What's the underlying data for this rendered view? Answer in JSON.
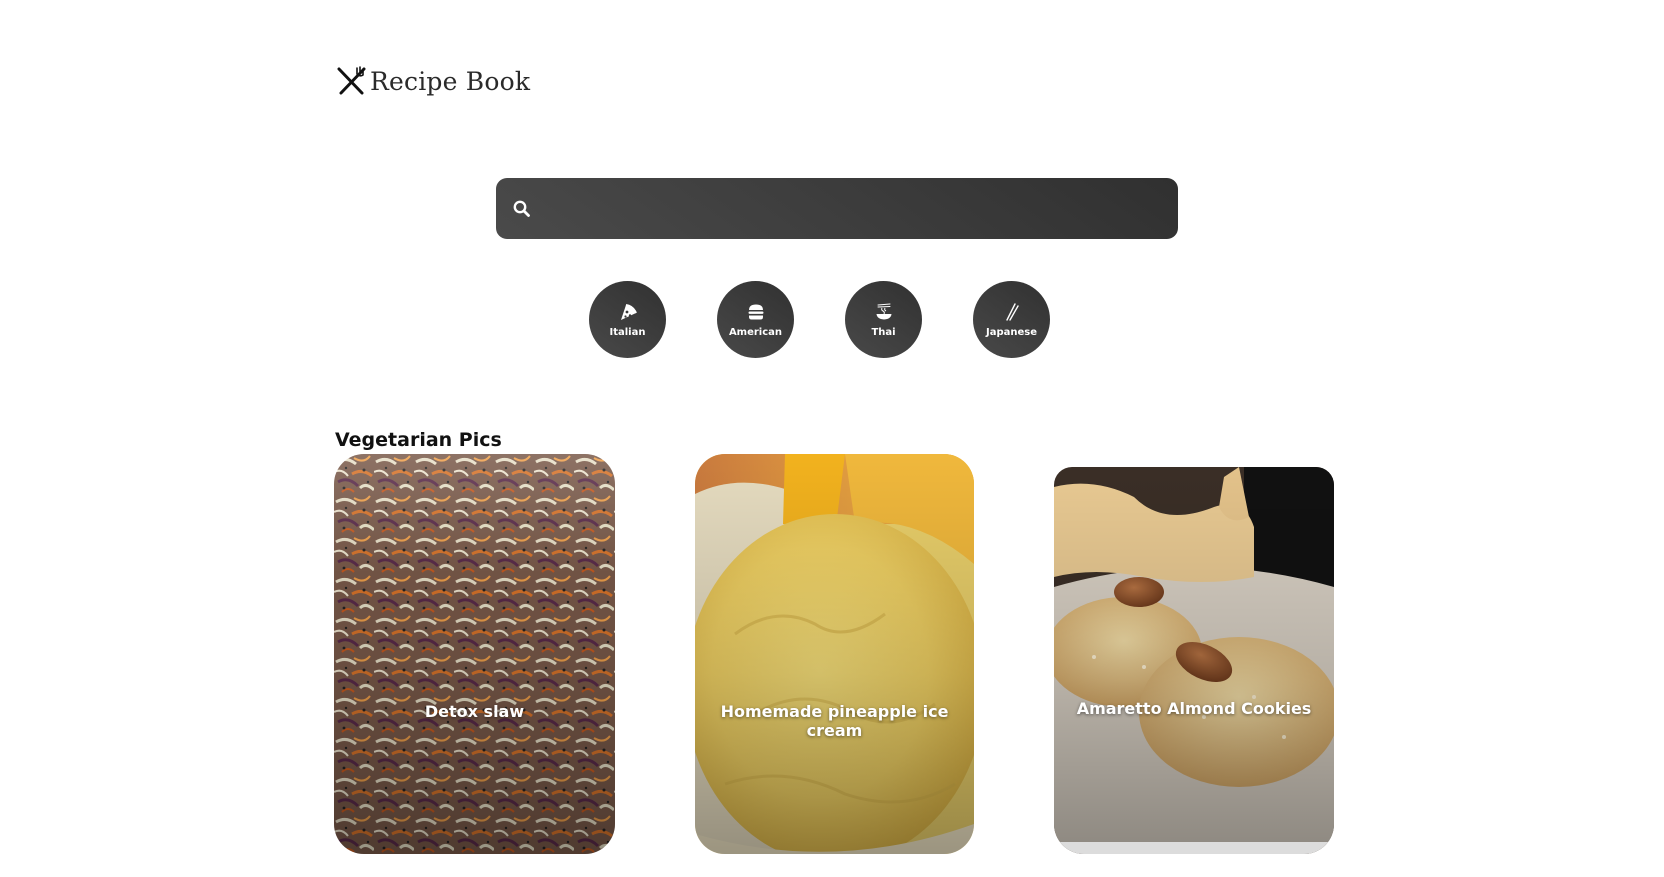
{
  "header": {
    "logo_icon": "fork-knife-crossed-icon",
    "logo_text": "Recipe Book"
  },
  "search": {
    "icon": "search-icon",
    "value": "",
    "placeholder": ""
  },
  "cuisines": [
    {
      "label": "Italian",
      "icon": "pizza-icon"
    },
    {
      "label": "American",
      "icon": "burger-icon"
    },
    {
      "label": "Thai",
      "icon": "noodle-bowl-icon"
    },
    {
      "label": "Japanese",
      "icon": "chopsticks-icon"
    }
  ],
  "section": {
    "title": "Vegetarian Pics"
  },
  "recipes": [
    {
      "title": "Detox slaw",
      "image": "shredded-cabbage-carrot-slaw-photo"
    },
    {
      "title": "Homemade pineapple ice cream",
      "image": "yellow-ice-cream-scoop-photo"
    },
    {
      "title": "Amaretto Almond Cookies",
      "image": "almond-cookies-on-plate-photo"
    }
  ],
  "colors": {
    "dark_control": "#3a3a3a",
    "text": "#111111",
    "background": "#ffffff"
  }
}
